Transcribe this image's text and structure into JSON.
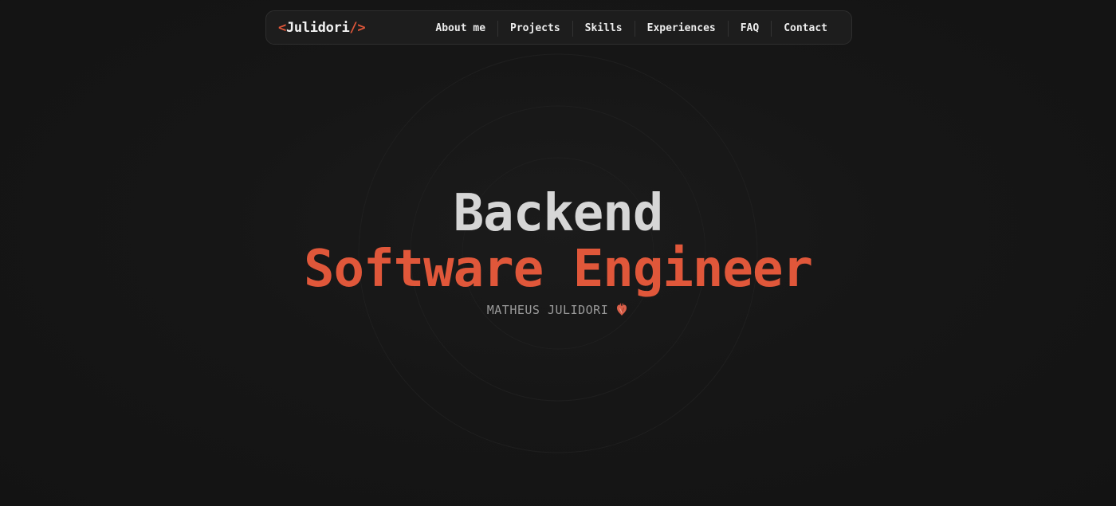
{
  "header": {
    "logo": {
      "open": "<",
      "name": "Julidori",
      "close": "/>"
    },
    "nav": [
      {
        "label": "About me"
      },
      {
        "label": "Projects"
      },
      {
        "label": "Skills"
      },
      {
        "label": "Experiences"
      },
      {
        "label": "FAQ"
      },
      {
        "label": "Contact"
      }
    ]
  },
  "hero": {
    "title_line1": "Backend",
    "title_line2": "Software Engineer",
    "name": "MATHEUS JULIDORI",
    "name_icon": "anatomical-heart-icon"
  },
  "colors": {
    "background": "#151515",
    "accent": "#e0573a",
    "title_light": "#d6d6d6",
    "nav_bg": "#1d1d1d"
  }
}
